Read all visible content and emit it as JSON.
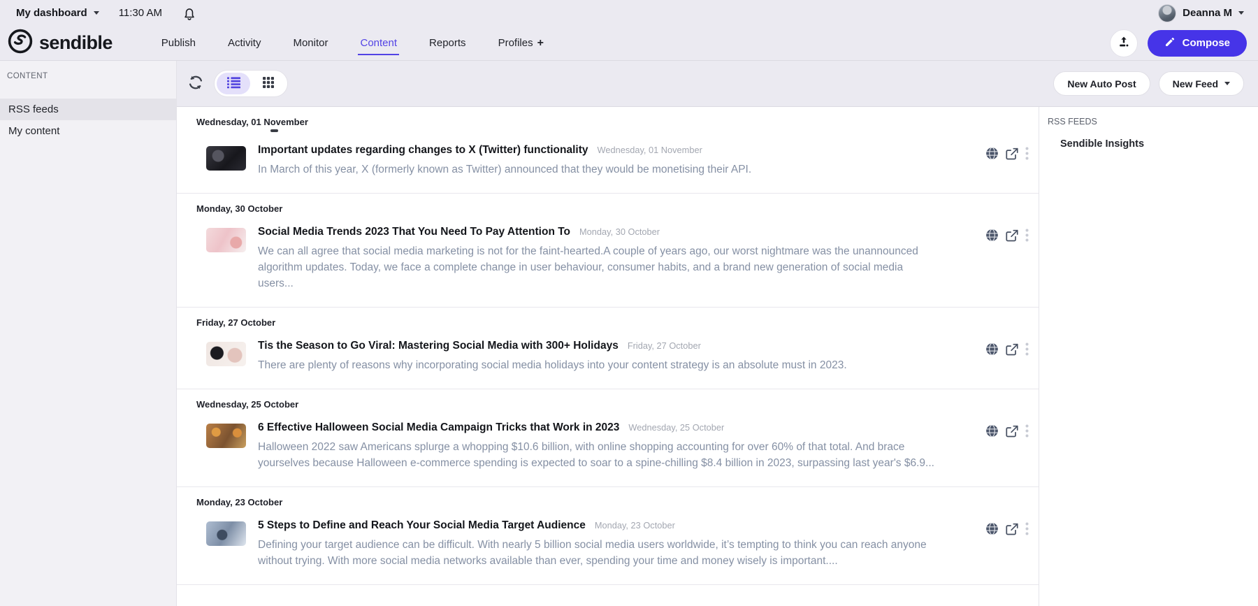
{
  "topbar": {
    "dashboard_label": "My dashboard",
    "time": "11:30 AM",
    "user_name": "Deanna M"
  },
  "navbar": {
    "brand": "sendible",
    "items": [
      {
        "label": "Publish"
      },
      {
        "label": "Activity"
      },
      {
        "label": "Monitor"
      },
      {
        "label": "Content",
        "active": true
      },
      {
        "label": "Reports"
      },
      {
        "label": "Profiles",
        "plus": true
      }
    ],
    "compose_label": "Compose"
  },
  "sidebar": {
    "section_title": "CONTENT",
    "items": [
      {
        "label": "RSS feeds",
        "selected": true
      },
      {
        "label": "My content",
        "selected": false
      }
    ]
  },
  "toolbar": {
    "new_auto_post": "New Auto Post",
    "new_feed": "New Feed"
  },
  "right_panel": {
    "title": "RSS FEEDS",
    "feeds": [
      "Sendible Insights"
    ]
  },
  "feed": {
    "groups": [
      {
        "date": "Wednesday, 01 November",
        "partial_loader": true,
        "articles": [
          {
            "title": "Important updates regarding changes to X (Twitter) functionality",
            "date": "Wednesday, 01 November",
            "excerpt": "In March of this year, X (formerly known as Twitter) announced that they would be monetising their API.",
            "thumb": "dark"
          }
        ]
      },
      {
        "date": "Monday, 30 October",
        "articles": [
          {
            "title": "Social Media Trends 2023 That You Need To Pay Attention To",
            "date": "Monday, 30 October",
            "excerpt": "We can all agree that social media marketing is not for the faint-hearted.A couple of years ago, our worst nightmare was the unannounced algorithm updates. Today, we face a complete change in user behaviour, consumer habits, and a brand new generation of social media users...",
            "thumb": "pink"
          }
        ]
      },
      {
        "date": "Friday, 27 October",
        "articles": [
          {
            "title": "Tis the Season to Go Viral: Mastering Social Media with 300+ Holidays",
            "date": "Friday, 27 October",
            "excerpt": "There are plenty of reasons why incorporating social media holidays into your content strategy is an absolute must in 2023.",
            "thumb": "holiday"
          }
        ]
      },
      {
        "date": "Wednesday, 25 October",
        "articles": [
          {
            "title": "6 Effective Halloween Social Media Campaign Tricks that Work in 2023",
            "date": "Wednesday, 25 October",
            "excerpt": "Halloween 2022 saw Americans splurge a whopping $10.6 billion, with online shopping accounting for over 60% of that total. And brace yourselves because Halloween e-commerce spending is expected to soar to a spine-chilling $8.4 billion in 2023, surpassing last year's $6.9...",
            "thumb": "halloween"
          }
        ]
      },
      {
        "date": "Monday, 23 October",
        "articles": [
          {
            "title": "5 Steps to Define and Reach Your Social Media Target Audience",
            "date": "Monday, 23 October",
            "excerpt": "Defining your target audience can be difficult. With nearly 5 billion social media users worldwide, it’s tempting to think you can reach anyone without trying.  With more social media networks available than ever, spending your time and money wisely is important....",
            "thumb": "office"
          }
        ]
      }
    ]
  },
  "colors": {
    "accent": "#4634e8",
    "accent_light": "#e4e0fa",
    "active_tab": "#5243e5",
    "topbar_bg": "#ebeaf1",
    "sidebar_bg": "#f2f1f5",
    "excerpt_text": "#8590a4"
  }
}
